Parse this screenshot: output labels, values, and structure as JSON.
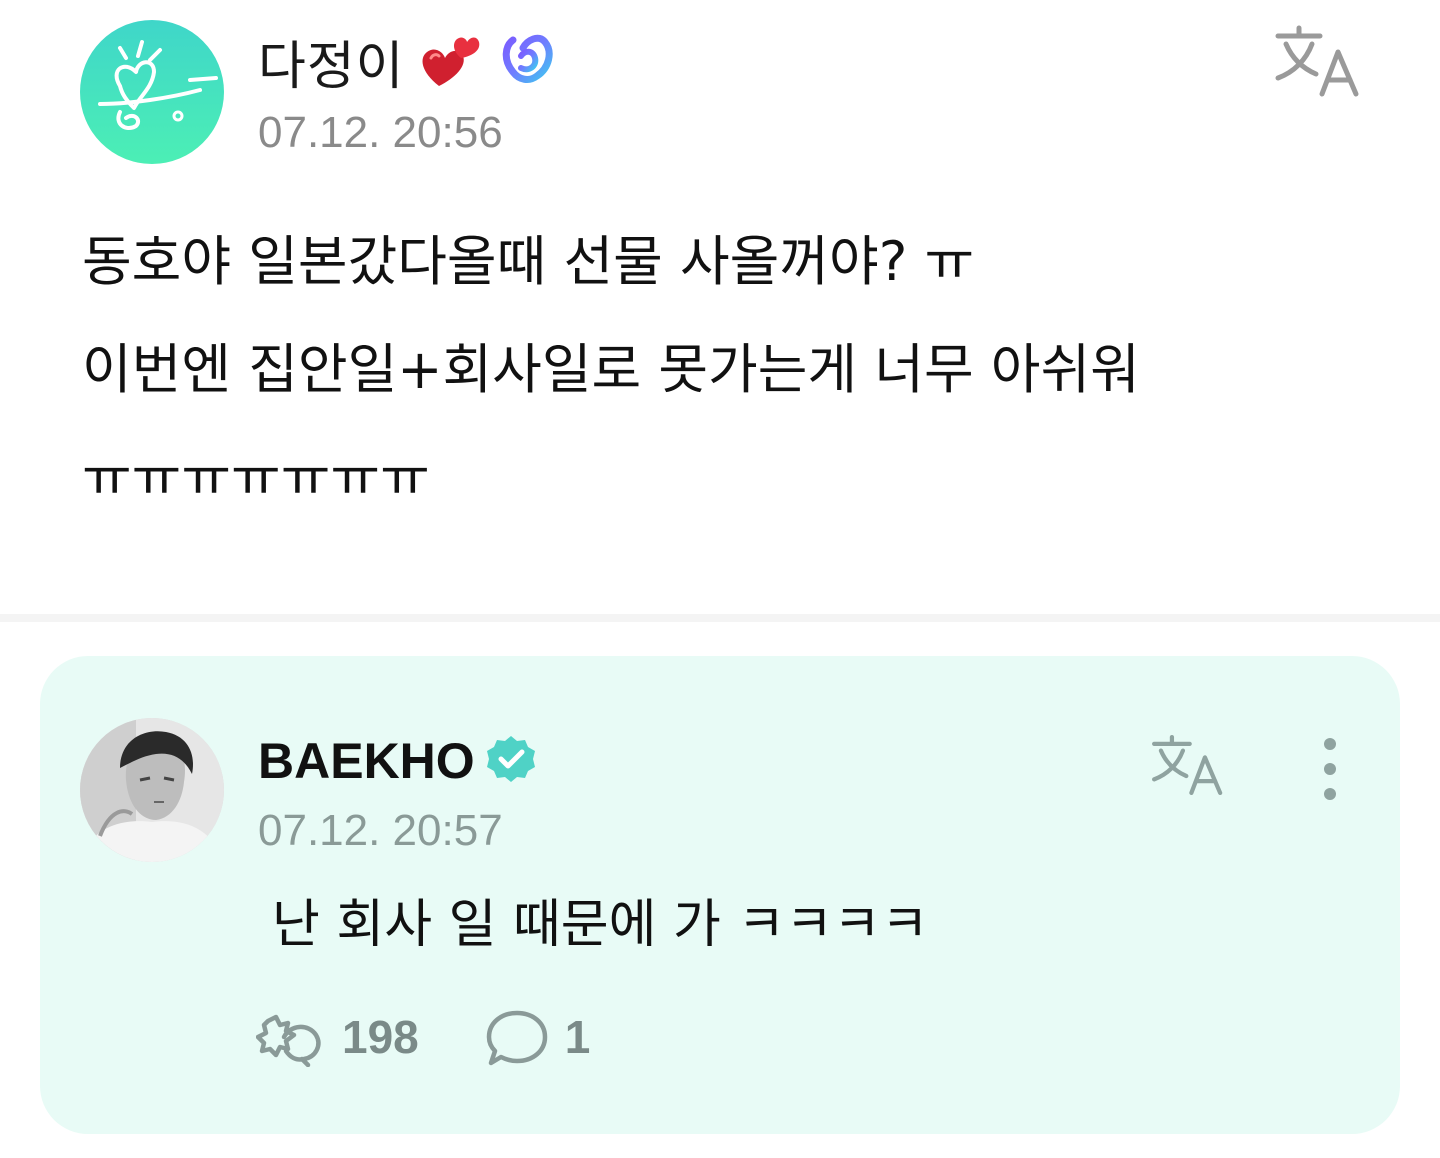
{
  "post": {
    "author": "다정이",
    "author_badges": [
      "two-hearts-emoji",
      "membership-badge-icon"
    ],
    "timestamp": "07.12. 20:56",
    "translate_icon": "translate-icon",
    "body_lines": [
      "동호야 일본갔다올때 선물 사올꺼야? ㅠ",
      "이번엔 집안일+회사일로 못가는게 너무 아쉬워",
      "ㅠㅠㅠㅠㅠㅠㅠ"
    ]
  },
  "reply": {
    "author": "BAEKHO",
    "verified_icon": "verified-check-icon",
    "timestamp": "07.12. 20:57",
    "translate_icon": "translate-icon",
    "more_icon": "more-vertical-icon",
    "text": "난 회사 일 때문에 가 ㅋㅋㅋㅋ",
    "likes": "198",
    "comments": "1",
    "like_icon": "like-reaction-icon",
    "comment_icon": "comment-bubble-icon"
  },
  "colors": {
    "post_avatar_bg": "#3fd6c9",
    "reply_card_bg": "#e8fbf6",
    "verified_badge": "#4fd2c6",
    "timestamp": "#8a8a8a",
    "stat_icon": "#8a9a98"
  }
}
